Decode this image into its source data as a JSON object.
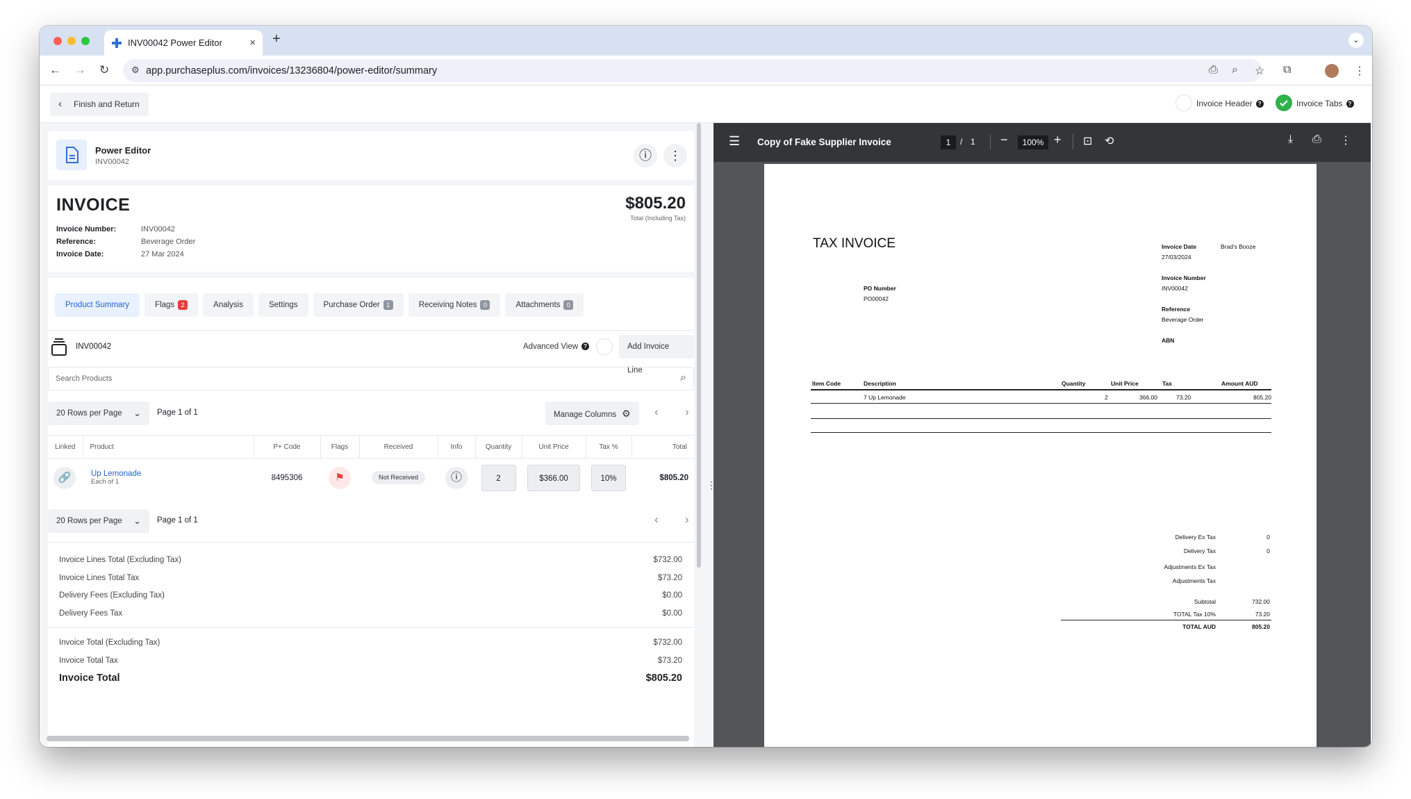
{
  "browser": {
    "tab_title": "INV00042 Power Editor",
    "url": "app.purchaseplus.com/invoices/13236804/power-editor/summary"
  },
  "topbar": {
    "finish_label": "Finish and Return",
    "invoice_header_label": "Invoice Header",
    "invoice_tabs_label": "Invoice Tabs"
  },
  "power_editor": {
    "title": "Power Editor",
    "subtitle": "INV00042"
  },
  "invoice": {
    "heading": "INVOICE",
    "total": "$805.20",
    "total_caption": "Total (Including Tax)",
    "fields": [
      {
        "label": "Invoice Number:",
        "value": "INV00042"
      },
      {
        "label": "Reference:",
        "value": "Beverage Order"
      },
      {
        "label": "Invoice Date:",
        "value": "27 Mar 2024"
      }
    ]
  },
  "tabs": [
    {
      "label": "Product Summary",
      "active": true
    },
    {
      "label": "Flags",
      "badge": "2",
      "badge_color": "#e53e3e"
    },
    {
      "label": "Analysis"
    },
    {
      "label": "Settings"
    },
    {
      "label": "Purchase Order",
      "badge": "1"
    },
    {
      "label": "Receiving Notes",
      "badge": "0"
    },
    {
      "label": "Attachments",
      "badge": "0"
    }
  ],
  "lines_section": {
    "invoice_ref": "INV00042",
    "advanced_view_label": "Advanced View",
    "add_line_label": "Add Invoice Line",
    "search_placeholder": "Search Products"
  },
  "pagination": {
    "rows_per_page": "20 Rows per Page",
    "page_label": "Page 1 of 1",
    "manage_columns": "Manage Columns"
  },
  "table": {
    "headers": [
      "Linked",
      "Product",
      "P+ Code",
      "Flags",
      "Received",
      "Info",
      "Quantity",
      "Unit Price",
      "Tax %",
      "Total"
    ],
    "rows": [
      {
        "product": "Up Lemonade",
        "product_sub": "Each of 1",
        "code": "8495306",
        "received": "Not Received",
        "quantity": "2",
        "unit_price": "$366.00",
        "tax": "10%",
        "total": "$805.20"
      }
    ]
  },
  "totals": {
    "group1": [
      {
        "label": "Invoice Lines Total (Excluding Tax)",
        "value": "$732.00"
      },
      {
        "label": "Invoice Lines Total Tax",
        "value": "$73.20"
      },
      {
        "label": "Delivery Fees (Excluding Tax)",
        "value": "$0.00"
      },
      {
        "label": "Delivery Fees Tax",
        "value": "$0.00"
      }
    ],
    "group2": [
      {
        "label": "Invoice Total (Excluding Tax)",
        "value": "$732.00"
      },
      {
        "label": "Invoice Total Tax",
        "value": "$73.20"
      }
    ],
    "grand": {
      "label": "Invoice Total",
      "value": "$805.20"
    }
  },
  "pdf": {
    "title": "Copy of Fake Supplier Invoice",
    "page_current": "1",
    "page_total": "1",
    "zoom": "100%",
    "doc": {
      "heading": "TAX INVOICE",
      "invoice_date_label": "Invoice Date",
      "invoice_date": "27/03/2024",
      "supplier": "Brad's Booze",
      "invoice_number_label": "Invoice Number",
      "invoice_number": "INV00042",
      "reference_label": "Reference",
      "reference": "Beverage Order",
      "abn_label": "ABN",
      "po_label": "PO Number",
      "po": "PO00042",
      "cols": [
        "Item Code",
        "Description",
        "Quantity",
        "Unit Price",
        "Tax",
        "Amount AUD"
      ],
      "line": {
        "description": "7 Up Lemonade",
        "quantity": "2",
        "unit_price": "366.00",
        "tax": "73.20",
        "amount": "805.20"
      },
      "summary": [
        {
          "label": "Delivery Ex Tax",
          "value": "0"
        },
        {
          "label": "Delivery Tax",
          "value": "0"
        },
        {
          "label": "Adjustments Ex Tax",
          "value": ""
        },
        {
          "label": "Adjustments Tax",
          "value": ""
        },
        {
          "label": "Subtotal",
          "value": "732.00"
        },
        {
          "label": "TOTAL Tax 10%",
          "value": "73.20"
        },
        {
          "label": "TOTAL AUD",
          "value": "805.20"
        }
      ]
    }
  }
}
